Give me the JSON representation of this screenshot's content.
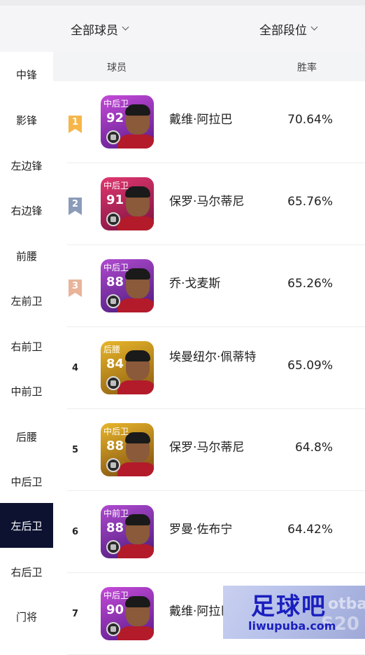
{
  "filters": {
    "players_label": "全部球员",
    "tier_label": "全部段位"
  },
  "table_header": {
    "player": "球员",
    "win_rate": "胜率"
  },
  "sidebar": {
    "items": [
      {
        "label": "中锋"
      },
      {
        "label": "影锋"
      },
      {
        "label": "左边锋"
      },
      {
        "label": "右边锋"
      },
      {
        "label": "前腰"
      },
      {
        "label": "左前卫"
      },
      {
        "label": "右前卫"
      },
      {
        "label": "中前卫"
      },
      {
        "label": "后腰"
      },
      {
        "label": "中后卫"
      },
      {
        "label": "左后卫"
      },
      {
        "label": "右后卫"
      },
      {
        "label": "门将"
      }
    ],
    "active": "左后卫"
  },
  "rows": [
    {
      "rank": "1",
      "badge_color": "#f6b64a",
      "position": "中后卫",
      "rating": "92",
      "name": "戴维·阿拉巴",
      "win_rate": "70.64%",
      "card_color_top": "#c44bd8",
      "card_color_bottom": "#5a1a8a"
    },
    {
      "rank": "2",
      "badge_color": "#8b9bb8",
      "position": "中后卫",
      "rating": "91",
      "name": "保罗·马尔蒂尼",
      "win_rate": "65.76%",
      "card_color_top": "#e0386e",
      "card_color_bottom": "#7a1040"
    },
    {
      "rank": "3",
      "badge_color": "#e9b49a",
      "position": "中后卫",
      "rating": "88",
      "name": "乔·戈麦斯",
      "win_rate": "65.26%",
      "card_color_top": "#b04ad0",
      "card_color_bottom": "#4a1a7a"
    },
    {
      "rank": "4",
      "badge_color": "",
      "position": "后腰",
      "rating": "84",
      "name": "埃曼纽尔·佩蒂特",
      "win_rate": "65.09%",
      "card_color_top": "#e8b62a",
      "card_color_bottom": "#8a5a10"
    },
    {
      "rank": "5",
      "badge_color": "",
      "position": "中后卫",
      "rating": "88",
      "name": "保罗·马尔蒂尼",
      "win_rate": "64.8%",
      "card_color_top": "#e8b62a",
      "card_color_bottom": "#7a4a10"
    },
    {
      "rank": "6",
      "badge_color": "",
      "position": "中前卫",
      "rating": "88",
      "name": "罗曼·佐布宁",
      "win_rate": "64.42%",
      "card_color_top": "#b04ad0",
      "card_color_bottom": "#4a1a7a"
    },
    {
      "rank": "7",
      "badge_color": "",
      "position": "中后卫",
      "rating": "90",
      "name": "戴维·阿拉巴",
      "win_rate": "",
      "card_color_top": "#c44bd8",
      "card_color_bottom": "#5a1a8a"
    }
  ],
  "watermark": {
    "title": "足球吧",
    "url": "liwupuba.com",
    "back_text_1": "otba",
    "back_text_2": "S20"
  }
}
